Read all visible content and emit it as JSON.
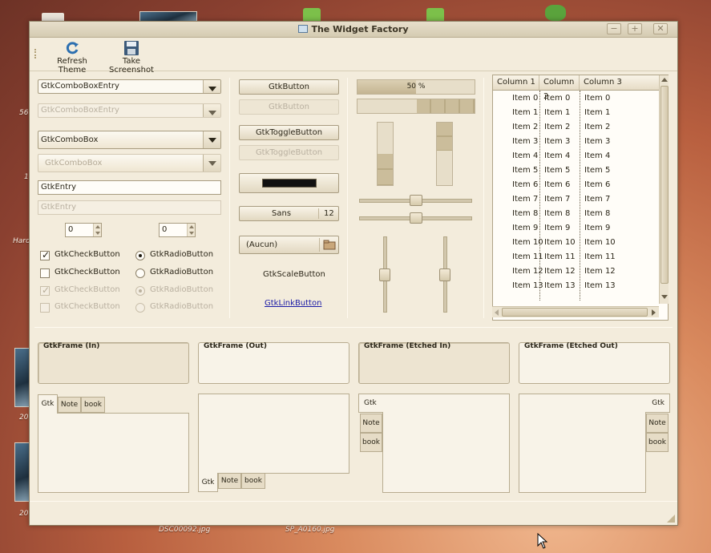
{
  "desktop": {
    "files": [
      "DSC00092.jpg",
      "SP_A0160.jpg"
    ],
    "left_labels": [
      "56",
      "1",
      "Hard",
      "20",
      "20"
    ]
  },
  "window": {
    "title": "The Widget Factory",
    "controls": [
      "−",
      "+",
      "✕"
    ]
  },
  "toolbar": {
    "refresh_label": "Refresh Theme",
    "screenshot_label": "Take Screenshot"
  },
  "col1": {
    "combo_entry": "GtkComboBoxEntry",
    "combo_entry_disabled": "GtkComboBoxEntry",
    "combo": "GtkComboBox",
    "combo_disabled": "GtkComboBox",
    "entry": "GtkEntry",
    "entry_disabled": "GtkEntry",
    "spin1": "0",
    "spin2": "0",
    "check1": "GtkCheckButton",
    "check2": "GtkCheckButton",
    "check3": "GtkCheckButton",
    "check4": "GtkCheckButton",
    "radio1": "GtkRadioButton",
    "radio2": "GtkRadioButton",
    "radio3": "GtkRadioButton",
    "radio4": "GtkRadioButton"
  },
  "col2": {
    "button": "GtkButton",
    "button_disabled": "GtkButton",
    "toggle": "GtkToggleButton",
    "toggle_disabled": "GtkToggleButton",
    "color_value": "#111111",
    "font_name": "Sans",
    "font_size": "12",
    "file_chooser": "(Aucun)",
    "scale_button": "GtkScaleButton",
    "link_button": "GtkLinkButton"
  },
  "col3": {
    "progress_text": "50 %",
    "progress_fraction": 0.5,
    "vprogress1_fraction": 0.5,
    "vprogress2_fraction": 0.45,
    "hscale1_value": 0.5,
    "hscale2_value": 0.5,
    "vscale1_value": 0.5,
    "vscale2_value": 0.5
  },
  "tree": {
    "columns": [
      "Column 1",
      "Column 2",
      "Column 3"
    ],
    "rows": [
      [
        "Item 0",
        "Item 0",
        "Item 0"
      ],
      [
        "Item 1",
        "Item 1",
        "Item 1"
      ],
      [
        "Item 2",
        "Item 2",
        "Item 2"
      ],
      [
        "Item 3",
        "Item 3",
        "Item 3"
      ],
      [
        "Item 4",
        "Item 4",
        "Item 4"
      ],
      [
        "Item 5",
        "Item 5",
        "Item 5"
      ],
      [
        "Item 6",
        "Item 6",
        "Item 6"
      ],
      [
        "Item 7",
        "Item 7",
        "Item 7"
      ],
      [
        "Item 8",
        "Item 8",
        "Item 8"
      ],
      [
        "Item 9",
        "Item 9",
        "Item 9"
      ],
      [
        "Item 10",
        "Item 10",
        "Item 10"
      ],
      [
        "Item 11",
        "Item 11",
        "Item 11"
      ],
      [
        "Item 12",
        "Item 12",
        "Item 12"
      ],
      [
        "Item 13",
        "Item 13",
        "Item 13"
      ]
    ]
  },
  "frames": {
    "in": "GtkFrame (In)",
    "out": "GtkFrame (Out)",
    "etched_in": "GtkFrame (Etched In)",
    "etched_out": "GtkFrame (Etched Out)"
  },
  "notebooks": {
    "tabs": [
      "Gtk",
      "Note",
      "book"
    ]
  },
  "colors": {
    "window_bg": "#f3ecdc",
    "accent": "#c4b592",
    "link": "#1a1aa6"
  }
}
